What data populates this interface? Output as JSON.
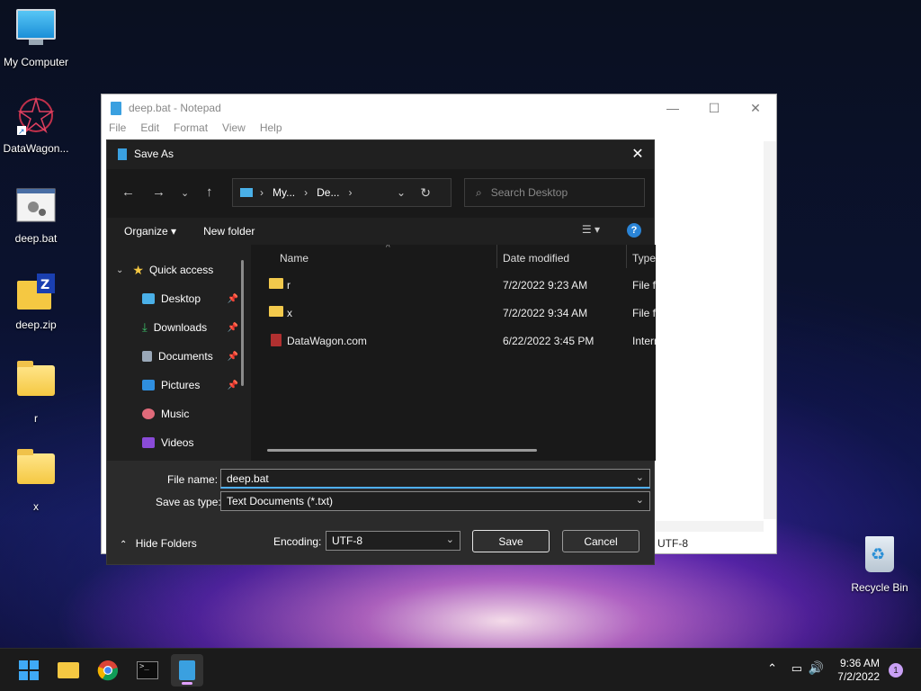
{
  "desktop": {
    "icons": [
      {
        "label": "My Computer",
        "icon": "monitor-icon"
      },
      {
        "label": "DataWagon...",
        "icon": "datawagon-icon"
      },
      {
        "label": "deep.bat",
        "icon": "batch-file-icon"
      },
      {
        "label": "deep.zip",
        "icon": "zip-folder-icon"
      },
      {
        "label": "r",
        "icon": "folder-icon"
      },
      {
        "label": "x",
        "icon": "folder-icon"
      }
    ],
    "recycle_bin": "Recycle Bin"
  },
  "notepad": {
    "title": "deep.bat - Notepad",
    "menu": [
      "File",
      "Edit",
      "Format",
      "View",
      "Help"
    ],
    "status_encoding": "UTF-8"
  },
  "save_dialog": {
    "title": "Save As",
    "breadcrumb": [
      "My...",
      "De..."
    ],
    "search_placeholder": "Search Desktop",
    "organize": "Organize",
    "new_folder": "New folder",
    "tree": [
      {
        "label": "Quick access",
        "pinned": false
      },
      {
        "label": "Desktop",
        "pinned": true
      },
      {
        "label": "Downloads",
        "pinned": true
      },
      {
        "label": "Documents",
        "pinned": true
      },
      {
        "label": "Pictures",
        "pinned": true
      },
      {
        "label": "Music",
        "pinned": false
      },
      {
        "label": "Videos",
        "pinned": false
      }
    ],
    "columns": [
      "Name",
      "Date modified",
      "Type"
    ],
    "files": [
      {
        "name": "r",
        "date": "7/2/2022 9:23 AM",
        "type": "File fo"
      },
      {
        "name": "x",
        "date": "7/2/2022 9:34 AM",
        "type": "File fo"
      },
      {
        "name": "DataWagon.com",
        "date": "6/22/2022 3:45 PM",
        "type": "Intern"
      }
    ],
    "file_name_label": "File name:",
    "file_name_value": "deep.bat",
    "save_as_type_label": "Save as type:",
    "save_as_type_value": "Text Documents (*.txt)",
    "hide_folders": "Hide Folders",
    "encoding_label": "Encoding:",
    "encoding_value": "UTF-8",
    "save_button": "Save",
    "cancel_button": "Cancel"
  },
  "taskbar": {
    "time": "9:36 AM",
    "date": "7/2/2022",
    "notification_count": "1"
  },
  "colors": {
    "accent": "#4fb0ff",
    "dialog_bg": "#202020",
    "taskbar_bg": "#1b1b1b"
  }
}
